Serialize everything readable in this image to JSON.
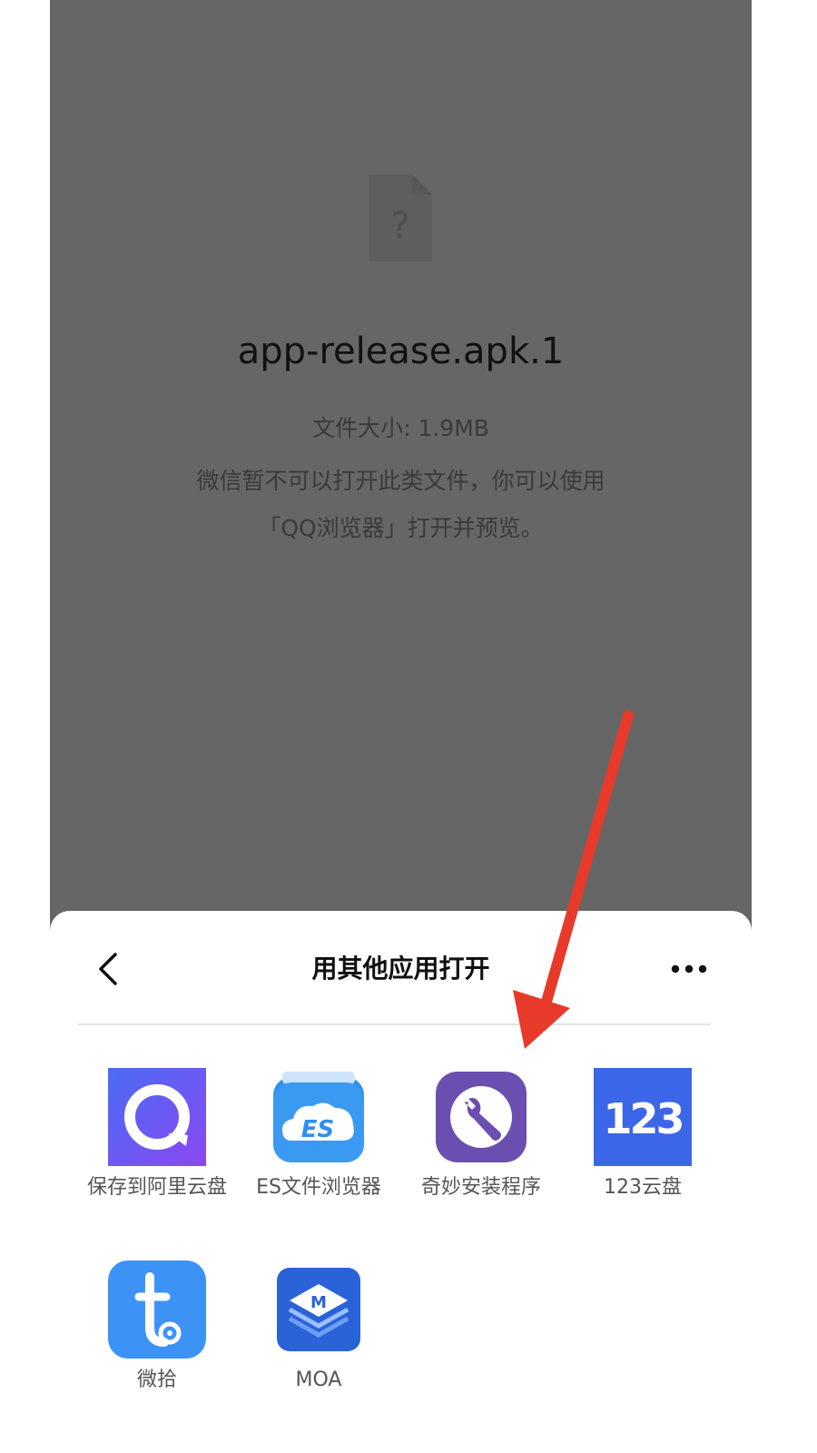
{
  "file": {
    "name": "app-release.apk.1",
    "size_text": "文件大小: 1.9MB",
    "notice_line1": "微信暂不可以打开此类文件，你可以使用",
    "notice_line2": "「QQ浏览器」打开并预览。",
    "icon": "unknown-file-icon"
  },
  "sheet": {
    "title": "用其他应用打开",
    "back_icon": "chevron-left-icon",
    "more_icon": "more-dots-icon",
    "apps": [
      {
        "label": "保存到阿里云盘",
        "icon": "aliyun-drive-icon"
      },
      {
        "label": "ES文件浏览器",
        "icon": "es-file-explorer-icon"
      },
      {
        "label": "奇妙安装程序",
        "icon": "installer-wrench-icon"
      },
      {
        "label": "123云盘",
        "icon": "123-cloud-icon"
      },
      {
        "label": "微拾",
        "icon": "weishi-icon"
      },
      {
        "label": "MOA",
        "icon": "moa-icon"
      }
    ]
  },
  "colors": {
    "overlay": "#666666",
    "arrow": "#e83a2a",
    "aliyun": "#6d55f0",
    "es": "#2f8ff0",
    "installer": "#6a4fb0",
    "cloud123": "#3b66e8",
    "weishi": "#3d93f5",
    "moa": "#2a62d8"
  }
}
